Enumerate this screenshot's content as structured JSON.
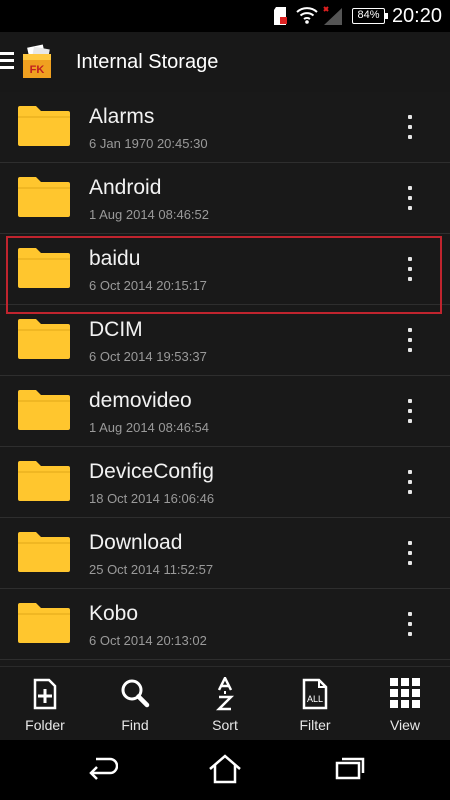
{
  "status_bar": {
    "time": "20:20",
    "battery": "84%"
  },
  "action_bar": {
    "title": "Internal Storage",
    "app_icon_text": "FK"
  },
  "files": [
    {
      "name": "Alarms",
      "date": "6 Jan 1970 20:45:30"
    },
    {
      "name": "Android",
      "date": "1 Aug 2014 08:46:52"
    },
    {
      "name": "baidu",
      "date": "6 Oct 2014 20:15:17",
      "selected": true
    },
    {
      "name": "DCIM",
      "date": "6 Oct 2014 19:53:37"
    },
    {
      "name": "demovideo",
      "date": "1 Aug 2014 08:46:54"
    },
    {
      "name": "DeviceConfig",
      "date": "18 Oct 2014 16:06:46"
    },
    {
      "name": "Download",
      "date": "25 Oct 2014 11:52:57"
    },
    {
      "name": "Kobo",
      "date": "6 Oct 2014 20:13:02"
    }
  ],
  "toolbar": {
    "folder_label": "Folder",
    "find_label": "Find",
    "sort_label": "Sort",
    "filter_label": "Filter",
    "view_label": "View"
  },
  "colors": {
    "folder": "#ffc62e",
    "selection": "#c0242e",
    "background": "#191919"
  },
  "icons": [
    "sd-card-icon",
    "wifi-icon",
    "signal-icon",
    "battery-icon",
    "menu-icon",
    "app-icon",
    "folder-icon",
    "more-vert-icon",
    "new-folder-icon",
    "search-icon",
    "sort-az-icon",
    "filter-all-icon",
    "grid-view-icon",
    "back-icon",
    "home-icon",
    "recents-icon"
  ]
}
